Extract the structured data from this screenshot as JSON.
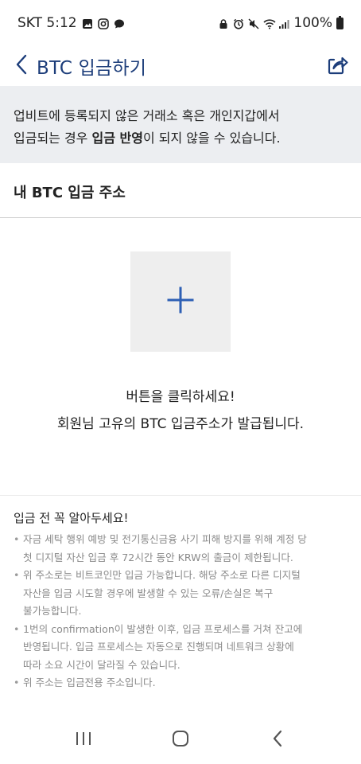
{
  "status": {
    "carrier_time": "SKT 5:12",
    "battery": "100%",
    "icons_left": [
      "gallery-icon",
      "instagram-icon",
      "chat-icon"
    ],
    "icons_right": [
      "lock-icon",
      "alarm-icon",
      "mute-icon",
      "wifi-icon",
      "signal-icon",
      "battery-icon"
    ]
  },
  "header": {
    "title": "BTC 입금하기",
    "back_icon": "chevron-left-icon",
    "share_icon": "share-icon"
  },
  "notice": {
    "line1": "업비트에 등록되지 않은 거래소 혹은 개인지갑에서",
    "line2_pre": "입금되는 경우 ",
    "line2_bold": "입금 반영",
    "line2_post": "이 되지 않을 수 있습니다."
  },
  "section": {
    "title": "내 BTC 입금 주소"
  },
  "address_generator": {
    "icon": "plus-icon",
    "guide_line1": "버튼을 클릭하세요!",
    "guide_line2": "회원님 고유의 BTC 입금주소가 발급됩니다."
  },
  "info": {
    "title": "입금 전 꼭 알아두세요!",
    "items": [
      [
        "자금 세탁 행위 예방 및 전기통신금융 사기 피해 방지를 위해 계정 당",
        "첫 디지털 자산 입금 후 72시간 동안 KRW의 출금이 제한됩니다."
      ],
      [
        "위 주소로는 비트코인만 입금 가능합니다. 해당 주소로 다른 디지털",
        "자산을 입금 시도할 경우에 발생할 수 있는 오류/손실은 복구",
        "불가능합니다."
      ],
      [
        "1번의 confirmation이 발생한 이후, 입금 프로세스를 거쳐 잔고에",
        "반영됩니다. 입금 프로세스는 자동으로 진행되며 네트워크 상황에",
        "따라 소요 시간이 달라질 수 있습니다."
      ],
      [
        "위 주소는 입금전용 주소입니다."
      ]
    ]
  },
  "navbar": {
    "recents_icon": "recents-icon",
    "home_icon": "home-icon",
    "back_icon": "nav-back-icon"
  },
  "colors": {
    "title": "#1c3d7a",
    "accent": "#2d5fb4",
    "notice_bg": "#eceef1",
    "box_bg": "#eeeeee",
    "muted_text": "#8a8a8a"
  }
}
